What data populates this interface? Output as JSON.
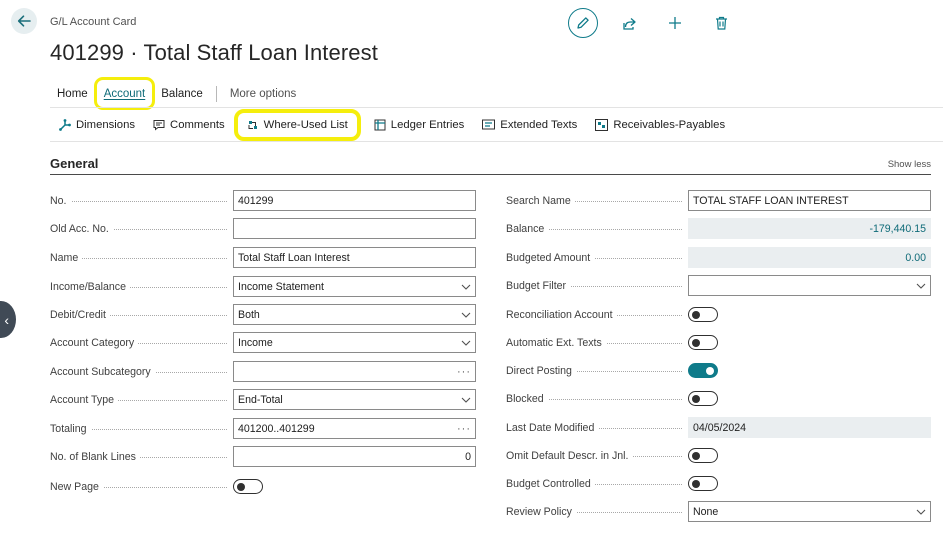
{
  "header": {
    "breadcrumb": "G/L Account Card",
    "title": "401299 · Total Staff Loan Interest"
  },
  "nav": {
    "home": "Home",
    "account": "Account",
    "balance": "Balance",
    "more": "More options"
  },
  "actions": {
    "dimensions": "Dimensions",
    "comments": "Comments",
    "where_used": "Where-Used List",
    "ledger": "Ledger Entries",
    "extended": "Extended Texts",
    "receivables": "Receivables-Payables"
  },
  "section": {
    "title": "General",
    "show_less": "Show less"
  },
  "left": {
    "no": {
      "label": "No.",
      "value": "401299"
    },
    "old_acc": {
      "label": "Old Acc. No.",
      "value": ""
    },
    "name": {
      "label": "Name",
      "value": "Total Staff Loan Interest"
    },
    "income_balance": {
      "label": "Income/Balance",
      "value": "Income Statement"
    },
    "debit_credit": {
      "label": "Debit/Credit",
      "value": "Both"
    },
    "category": {
      "label": "Account Category",
      "value": "Income"
    },
    "subcategory": {
      "label": "Account Subcategory",
      "value": ""
    },
    "type": {
      "label": "Account Type",
      "value": "End-Total"
    },
    "totaling": {
      "label": "Totaling",
      "value": "401200..401299"
    },
    "blank_lines": {
      "label": "No. of Blank Lines",
      "value": "0"
    },
    "new_page": {
      "label": "New Page",
      "value": false
    }
  },
  "right": {
    "search_name": {
      "label": "Search Name",
      "value": "TOTAL STAFF LOAN INTEREST"
    },
    "balance": {
      "label": "Balance",
      "value": "-179,440.15"
    },
    "budgeted": {
      "label": "Budgeted Amount",
      "value": "0.00"
    },
    "budget_filter": {
      "label": "Budget Filter",
      "value": ""
    },
    "reconciliation": {
      "label": "Reconciliation Account",
      "value": false
    },
    "auto_ext": {
      "label": "Automatic Ext. Texts",
      "value": false
    },
    "direct_posting": {
      "label": "Direct Posting",
      "value": true
    },
    "blocked": {
      "label": "Blocked",
      "value": false
    },
    "last_modified": {
      "label": "Last Date Modified",
      "value": "04/05/2024"
    },
    "omit_default": {
      "label": "Omit Default Descr. in Jnl.",
      "value": false
    },
    "budget_controlled": {
      "label": "Budget Controlled",
      "value": false
    },
    "review_policy": {
      "label": "Review Policy",
      "value": "None"
    }
  },
  "colors": {
    "accent": "#0f7b8a",
    "highlight": "#f5ee0c"
  }
}
